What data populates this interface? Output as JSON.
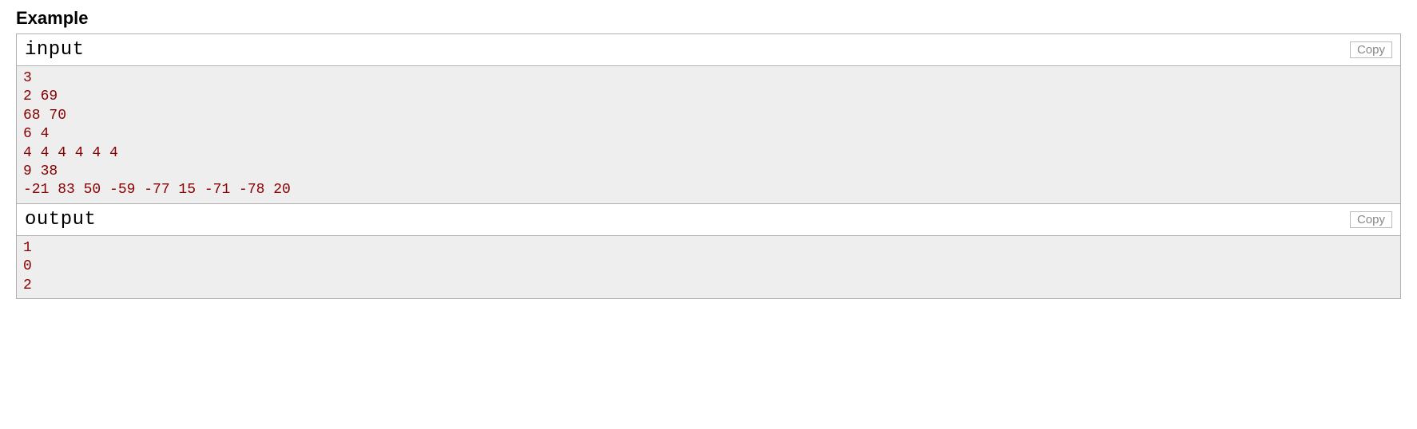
{
  "title": "Example",
  "input": {
    "label": "input",
    "copy_label": "Copy",
    "content": "3\n2 69\n68 70\n6 4\n4 4 4 4 4 4\n9 38\n-21 83 50 -59 -77 15 -71 -78 20"
  },
  "output": {
    "label": "output",
    "copy_label": "Copy",
    "content": "1\n0\n2"
  }
}
